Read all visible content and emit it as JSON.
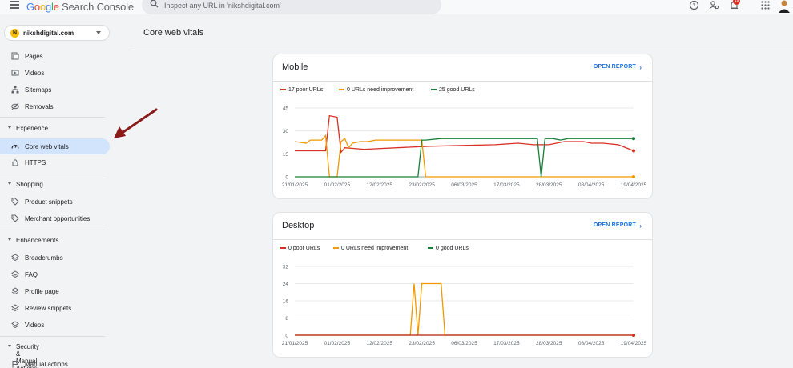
{
  "app": {
    "logo_letters": [
      "G",
      "o",
      "o",
      "g",
      "l",
      "e"
    ],
    "logo_suffix": "Search Console",
    "search_placeholder": "Inspect any URL in 'nikshdigital.com'",
    "notification_count": "19"
  },
  "sidebar": {
    "property": "nikshdigital.com",
    "items_top": [
      {
        "label": "Pages",
        "icon": "pages-icon"
      },
      {
        "label": "Videos",
        "icon": "video-icon"
      },
      {
        "label": "Sitemaps",
        "icon": "sitemap-icon"
      },
      {
        "label": "Removals",
        "icon": "removals-icon"
      }
    ],
    "experience": {
      "label": "Experience",
      "items": [
        {
          "label": "Core web vitals",
          "icon": "speed-icon",
          "active": true
        },
        {
          "label": "HTTPS",
          "icon": "lock-icon"
        }
      ]
    },
    "shopping": {
      "label": "Shopping",
      "items": [
        {
          "label": "Product snippets",
          "icon": "tag-icon"
        },
        {
          "label": "Merchant opportunities",
          "icon": "tag-icon"
        }
      ]
    },
    "enhancements": {
      "label": "Enhancements",
      "items": [
        {
          "label": "Breadcrumbs",
          "icon": "layers-icon"
        },
        {
          "label": "FAQ",
          "icon": "layers-icon"
        },
        {
          "label": "Profile page",
          "icon": "layers-icon"
        },
        {
          "label": "Review snippets",
          "icon": "layers-icon"
        },
        {
          "label": "Videos",
          "icon": "layers-icon"
        }
      ]
    },
    "security": {
      "label": "Security & Manual Actions",
      "items": [
        {
          "label": "Manual actions",
          "icon": "flag-icon"
        }
      ]
    }
  },
  "main": {
    "title": "Core web vitals",
    "open_report": "OPEN REPORT"
  },
  "colors": {
    "poor": "#d93025",
    "needs": "#f29900",
    "good": "#188038",
    "accent": "#1a73e8"
  },
  "chart_data": [
    {
      "type": "line",
      "title": "Mobile",
      "legend": [
        "17 poor URLs",
        "0 URLs need improvement",
        "25 good URLs"
      ],
      "x_ticks": [
        "21/01/2025",
        "01/02/2025",
        "12/02/2025",
        "23/02/2025",
        "06/03/2025",
        "17/03/2025",
        "28/03/2025",
        "08/04/2025",
        "19/04/2025"
      ],
      "y_ticks": [
        "45",
        "30",
        "15",
        "0"
      ],
      "ylim": [
        0,
        45
      ],
      "x_days": 88,
      "series": [
        {
          "name": "17 poor URLs",
          "color_key": "poor",
          "points": [
            [
              0,
              17
            ],
            [
              8,
              17
            ],
            [
              9,
              40
            ],
            [
              11,
              39
            ],
            [
              12,
              16
            ],
            [
              13,
              19
            ],
            [
              18,
              18
            ],
            [
              35,
              20
            ],
            [
              52,
              21
            ],
            [
              58,
              22
            ],
            [
              62,
              21
            ],
            [
              66,
              21
            ],
            [
              70,
              23
            ],
            [
              75,
              23
            ],
            [
              77,
              22
            ],
            [
              80,
              22
            ],
            [
              84,
              21
            ],
            [
              88,
              17
            ]
          ]
        },
        {
          "name": "0 URLs need improvement",
          "color_key": "needs",
          "points": [
            [
              0,
              23
            ],
            [
              3,
              22
            ],
            [
              4,
              24
            ],
            [
              7,
              24
            ],
            [
              8,
              27
            ],
            [
              9,
              0
            ],
            [
              11,
              0
            ],
            [
              12,
              23
            ],
            [
              13,
              25
            ],
            [
              14,
              19
            ],
            [
              15,
              22
            ],
            [
              17,
              23
            ],
            [
              19,
              23
            ],
            [
              21,
              24
            ],
            [
              33,
              24
            ],
            [
              34,
              0
            ],
            [
              88,
              0
            ]
          ]
        },
        {
          "name": "25 good URLs",
          "color_key": "good",
          "points": [
            [
              0,
              0
            ],
            [
              32,
              0
            ],
            [
              33,
              24
            ],
            [
              34,
              24
            ],
            [
              38,
              25
            ],
            [
              60,
              25
            ],
            [
              63,
              25
            ],
            [
              64,
              0
            ],
            [
              65,
              25
            ],
            [
              67,
              25
            ],
            [
              69,
              24
            ],
            [
              71,
              25
            ],
            [
              88,
              25
            ]
          ]
        }
      ]
    },
    {
      "type": "line",
      "title": "Desktop",
      "legend": [
        "0 poor URLs",
        "0 URLs need improvement",
        "0 good URLs"
      ],
      "x_ticks": [
        "21/01/2025",
        "01/02/2025",
        "12/02/2025",
        "23/02/2025",
        "06/03/2025",
        "17/03/2025",
        "28/03/2025",
        "08/04/2025",
        "19/04/2025"
      ],
      "y_ticks": [
        "32",
        "24",
        "16",
        "8",
        "0"
      ],
      "ylim": [
        0,
        32
      ],
      "x_days": 88,
      "series": [
        {
          "name": "0 URLs need improvement",
          "color_key": "needs",
          "points": [
            [
              0,
              0
            ],
            [
              30,
              0
            ],
            [
              31,
              24
            ],
            [
              32,
              0
            ],
            [
              33,
              24
            ],
            [
              38,
              24
            ],
            [
              39,
              0
            ],
            [
              88,
              0
            ]
          ]
        },
        {
          "name": "0 good URLs",
          "color_key": "good",
          "points": [
            [
              0,
              0
            ],
            [
              88,
              0
            ]
          ]
        },
        {
          "name": "0 poor URLs",
          "color_key": "poor",
          "points": [
            [
              0,
              0
            ],
            [
              88,
              0
            ]
          ]
        }
      ]
    }
  ]
}
